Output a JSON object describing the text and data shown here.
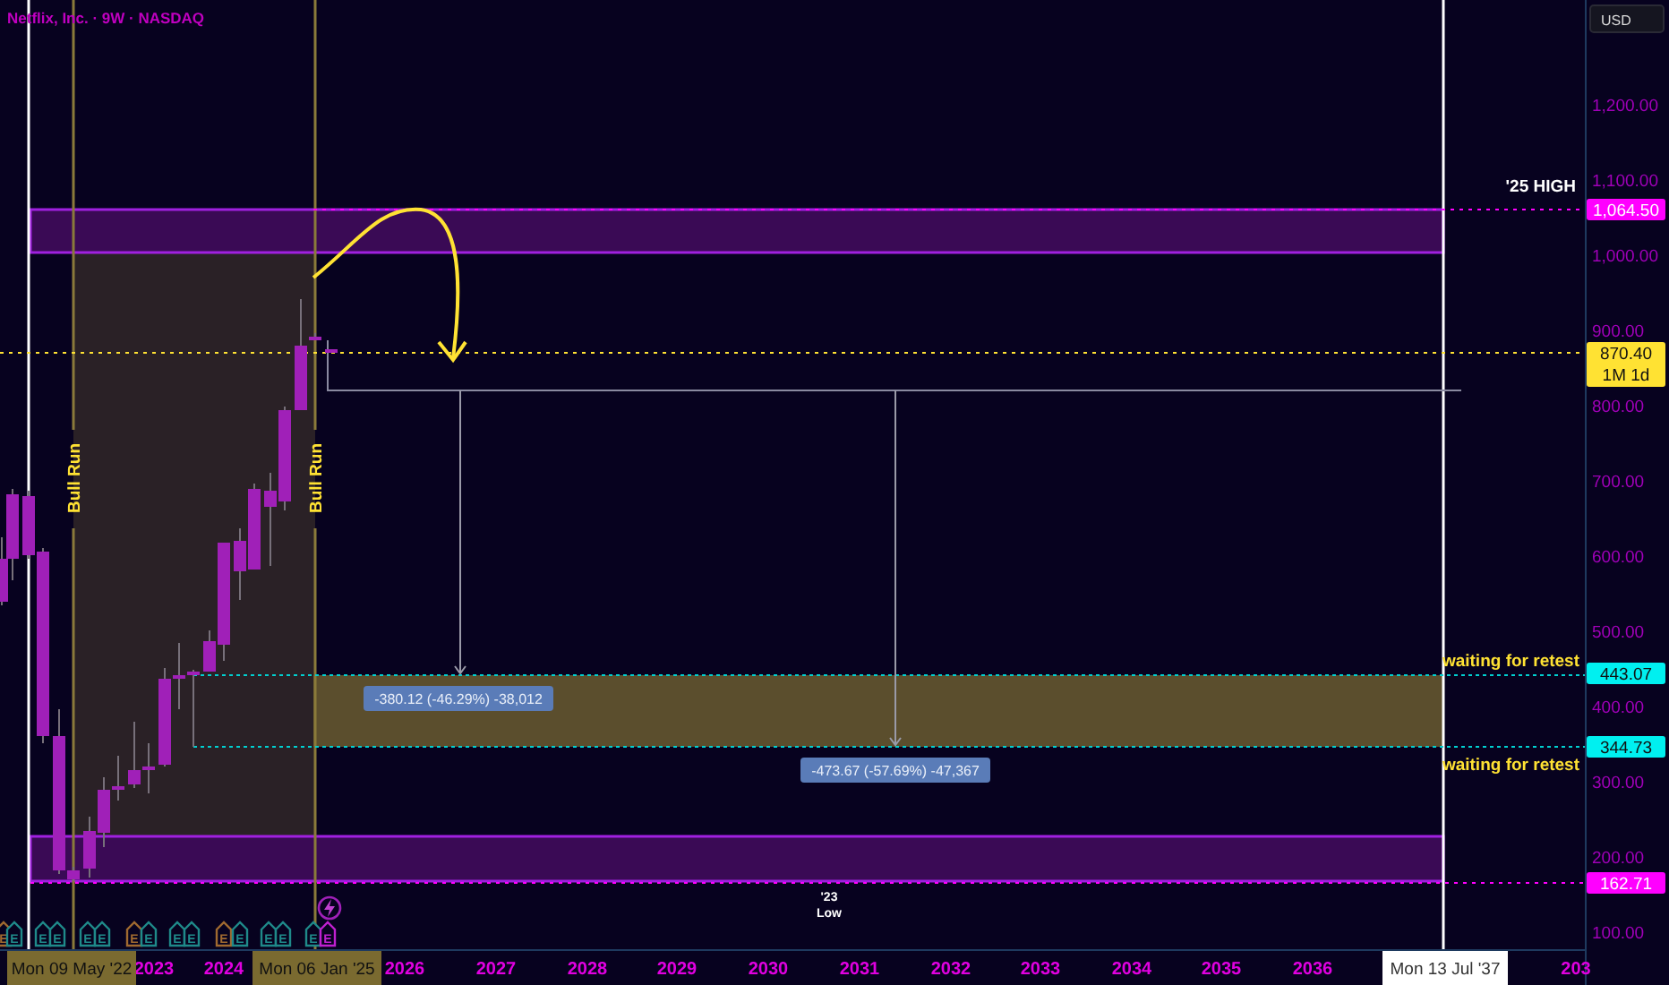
{
  "title": "Netflix, Inc. · 9W · NASDAQ",
  "currency_button": "USD",
  "price_axis": {
    "labels": [
      "1,200.00",
      "1,100.00",
      "1,000.00",
      "900.00",
      "800.00",
      "700.00",
      "600.00",
      "500.00",
      "400.00",
      "300.00",
      "200.00",
      "100.00"
    ]
  },
  "price_badges": [
    {
      "label": "1,064.50",
      "color": "#ff00ff"
    },
    {
      "label": "870.40",
      "sublabel": "1M 1d",
      "color": "#ffe233"
    },
    {
      "label": "443.07",
      "color": "#00f0f0"
    },
    {
      "label": "344.73",
      "color": "#00f0f0"
    },
    {
      "label": "162.71",
      "color": "#ff00ff"
    }
  ],
  "time_axis": {
    "labels": [
      "2023",
      "2024",
      "2026",
      "2027",
      "2028",
      "2029",
      "2030",
      "2031",
      "2032",
      "2033",
      "2034",
      "2035",
      "2036",
      "203"
    ]
  },
  "crosshair_labels": [
    {
      "label": "Mon 09 May '22",
      "color": "#7a6a30"
    },
    {
      "label": "Mon 06 Jan '25",
      "color": "#7a6a30"
    },
    {
      "label": "Mon 13 Jul '37",
      "color": "#ffffff"
    }
  ],
  "annotations": [
    {
      "kind": "note",
      "text": "'25 HIGH",
      "color": "#ffffff"
    },
    {
      "kind": "note",
      "text": "waiting for retest",
      "color": "#ffe233"
    },
    {
      "kind": "note",
      "text": "waiting for retest",
      "color": "#ffe233"
    },
    {
      "kind": "vertical",
      "text": "Bull Run",
      "color": "#ffe233"
    },
    {
      "kind": "vertical",
      "text": "Bull Run",
      "color": "#ffe233"
    },
    {
      "kind": "small",
      "text": "'23",
      "color": "#ffffff"
    },
    {
      "kind": "small",
      "text": "Low",
      "color": "#ffffff"
    }
  ],
  "measurements": [
    "-380.12 (-46.29%) -38,012",
    "-473.67 (-57.69%) -47,367"
  ],
  "earnings_markers": [
    {
      "label": "E",
      "color": "#a06a30"
    },
    {
      "label": "E",
      "color": "#1f8a8a"
    },
    {
      "label": "E",
      "color": "#1f8a8a"
    },
    {
      "label": "E",
      "color": "#1f8a8a"
    },
    {
      "label": "E",
      "color": "#1f8a8a"
    },
    {
      "label": "E",
      "color": "#1f8a8a"
    },
    {
      "label": "E",
      "color": "#a06a30"
    },
    {
      "label": "E",
      "color": "#1f8a8a"
    },
    {
      "label": "E",
      "color": "#1f8a8a"
    },
    {
      "label": "E",
      "color": "#1f8a8a"
    },
    {
      "label": "E",
      "color": "#a06a30"
    },
    {
      "label": "E",
      "color": "#1f8a8a"
    },
    {
      "label": "E",
      "color": "#1f8a8a"
    },
    {
      "label": "E",
      "color": "#1f8a8a"
    },
    {
      "label": "E",
      "color": "#1f8a8a"
    },
    {
      "label": "E",
      "color": "#c020d0"
    }
  ]
}
